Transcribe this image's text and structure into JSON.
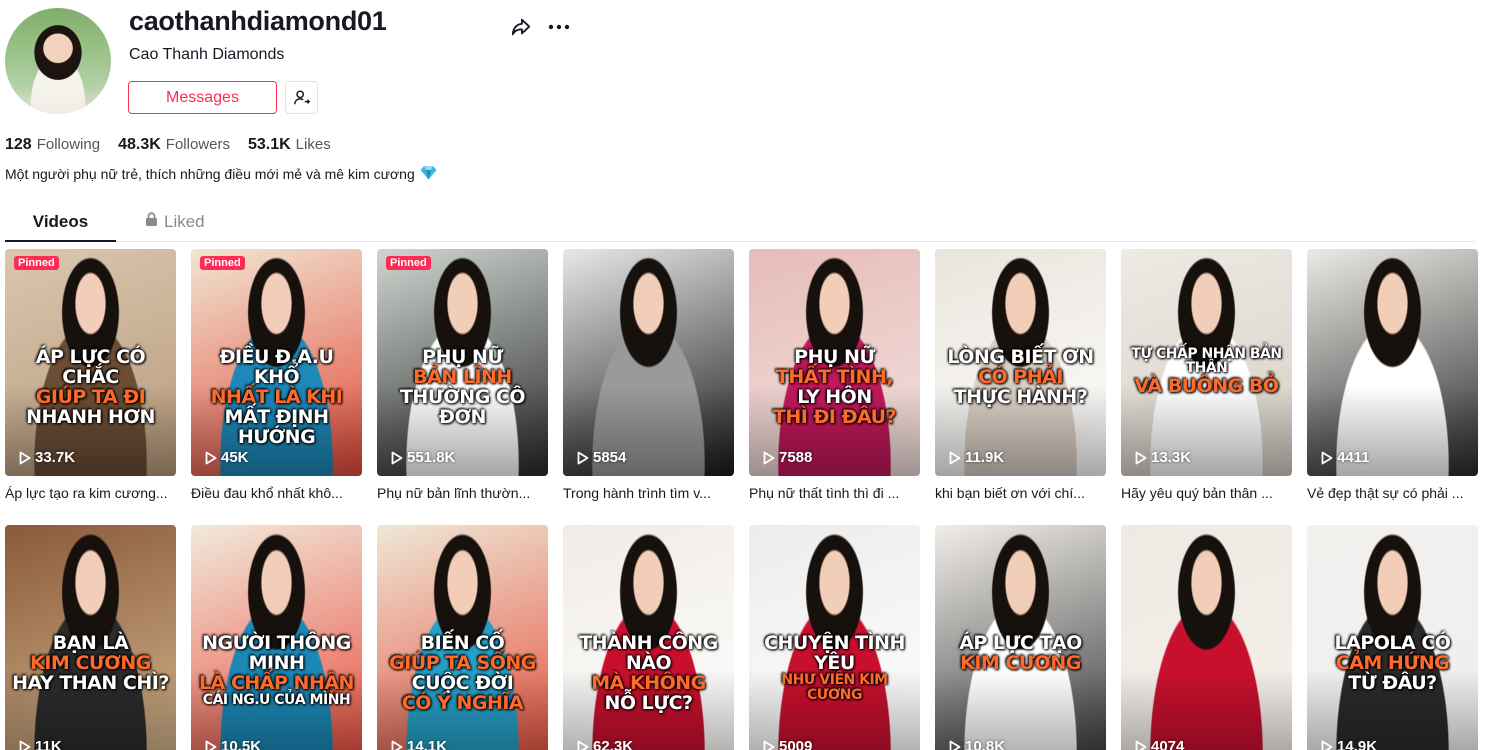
{
  "profile": {
    "username": "caothanhdiamond01",
    "nickname": "Cao Thanh Diamonds",
    "message_label": "Messages",
    "stats": {
      "following_value": "128",
      "following_label": "Following",
      "followers_value": "48.3K",
      "followers_label": "Followers",
      "likes_value": "53.1K",
      "likes_label": "Likes"
    },
    "bio": "Một người phụ nữ trẻ, thích những điều mới mẻ và mê kim cương",
    "bio_icon": "gem-icon"
  },
  "tabs": {
    "videos": "Videos",
    "liked": "Liked"
  },
  "pinned_label": "Pinned",
  "colors": {
    "accent": "#fe2c55",
    "text": "#161823",
    "muted": "#8a8b91"
  },
  "videos": [
    {
      "views": "33.7K",
      "caption": "Áp lực tạo ra kim cương...",
      "pinned": true,
      "overlay": [
        "ÁP LỰC CÓ CHẮC",
        "GIÚP TA ĐI",
        "NHANH HƠN"
      ]
    },
    {
      "views": "45K",
      "caption": "Điều đau khổ nhất khô...",
      "pinned": true,
      "overlay": [
        "ĐIỀU Đ.A.U KHỔ",
        "NHẤT LÀ KHI",
        "MẤT ĐỊNH HƯỚNG"
      ]
    },
    {
      "views": "551.8K",
      "caption": "Phụ nữ bản lĩnh thườn...",
      "pinned": true,
      "overlay": [
        "PHỤ NỮ",
        "BẢN LĨNH",
        "THƯỜNG CÔ ĐƠN"
      ]
    },
    {
      "views": "5854",
      "caption": "Trong hành trình tìm v...",
      "pinned": false,
      "overlay": []
    },
    {
      "views": "7588",
      "caption": "Phụ nữ thất tình thì đi ...",
      "pinned": false,
      "overlay": [
        "PHỤ NỮ",
        "THẤT TÌNH,",
        "LY HÔN",
        "THÌ ĐI ĐÂU?"
      ]
    },
    {
      "views": "11.9K",
      "caption": "khi bạn biết ơn với chí...",
      "pinned": false,
      "overlay": [
        "LÒNG BIẾT ƠN",
        "CÓ PHẢI",
        "THỰC HÀNH?"
      ]
    },
    {
      "views": "13.3K",
      "caption": "Hãy yêu quý bản thân ...",
      "pinned": false,
      "overlay": [
        "TỰ CHẤP NHẬN BẢN THÂN",
        "VÀ BUÔNG BỎ"
      ]
    },
    {
      "views": "4411",
      "caption": "Vẻ đẹp thật sự có phải ...",
      "pinned": false,
      "overlay": []
    },
    {
      "views": "11K",
      "caption": "",
      "pinned": false,
      "overlay": [
        "BẠN LÀ",
        "KIM CƯƠNG",
        "HAY THAN CHÌ?"
      ]
    },
    {
      "views": "10.5K",
      "caption": "",
      "pinned": false,
      "overlay": [
        "NGƯỜI THÔNG MINH",
        "LÀ CHẤP NHẬN",
        "CÁI NG.U CỦA MÌNH"
      ]
    },
    {
      "views": "14.1K",
      "caption": "",
      "pinned": false,
      "overlay": [
        "BIẾN CỐ",
        "GIÚP TA SỐNG",
        "CUỘC ĐỜI",
        "CÓ Ý NGHĨA"
      ]
    },
    {
      "views": "62.3K",
      "caption": "",
      "pinned": false,
      "overlay": [
        "THÀNH CÔNG NÀO",
        "MÀ KHÔNG",
        "NỖ LỰC?"
      ]
    },
    {
      "views": "5009",
      "caption": "",
      "pinned": false,
      "overlay": [
        "CHUYỆN TÌNH YÊU",
        "NHƯ VIÊN KIM CƯƠNG"
      ]
    },
    {
      "views": "10.8K",
      "caption": "",
      "pinned": false,
      "overlay": [
        "ÁP LỰC TẠO",
        "KIM CƯƠNG"
      ]
    },
    {
      "views": "4074",
      "caption": "",
      "pinned": false,
      "overlay": []
    },
    {
      "views": "14.9K",
      "caption": "",
      "pinned": false,
      "overlay": [
        "LAPOLA CÓ",
        "CẢM HỨNG",
        "TỪ ĐÂU?"
      ]
    }
  ]
}
